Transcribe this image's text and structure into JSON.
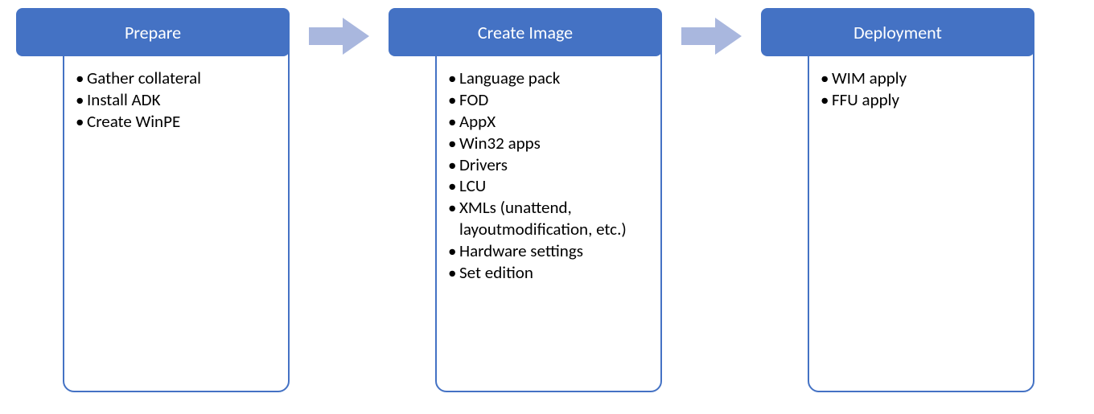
{
  "stages": [
    {
      "title": "Prepare",
      "items": [
        "Gather collateral",
        "Install ADK",
        "Create WinPE"
      ]
    },
    {
      "title": "Create Image",
      "items": [
        "Language pack",
        "FOD",
        "AppX",
        "Win32 apps",
        "Drivers",
        "LCU",
        "XMLs (unattend, layoutmodification, etc.)",
        "Hardware settings",
        "Set edition"
      ]
    },
    {
      "title": "Deployment",
      "items": [
        "WIM apply",
        "FFU apply"
      ]
    }
  ],
  "colors": {
    "primary": "#4472c4",
    "arrow": "#a9b7de"
  }
}
